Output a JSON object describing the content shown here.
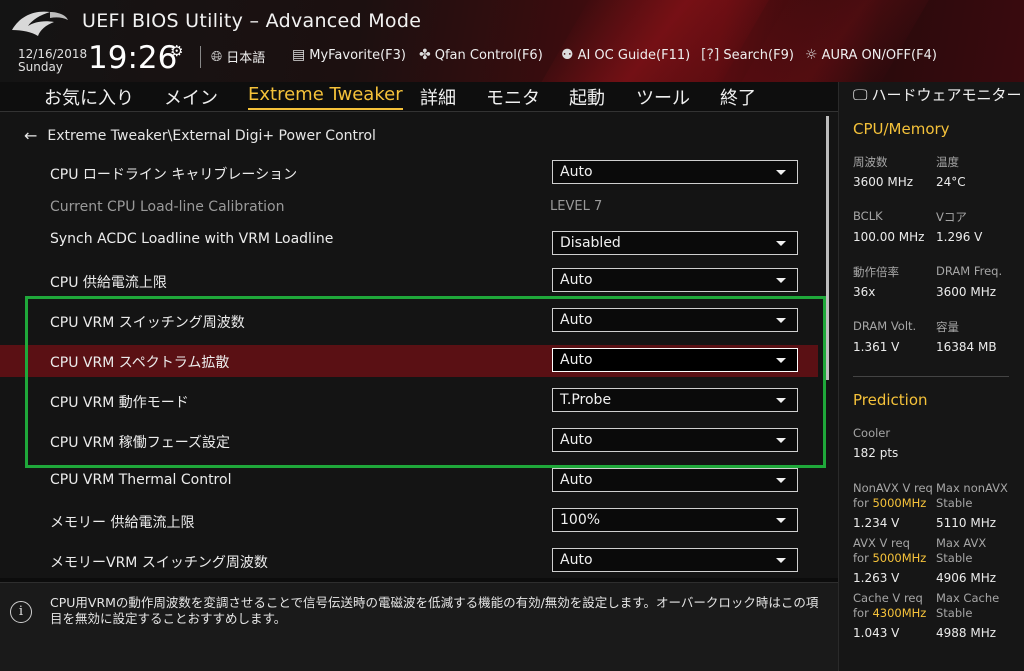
{
  "header": {
    "title": "UEFI BIOS Utility – Advanced Mode",
    "date": "12/16/2018",
    "day": "Sunday",
    "time": "19:26",
    "items": [
      {
        "icon": "globe-icon",
        "label": "日本語"
      },
      {
        "icon": "favorite-icon",
        "label": "MyFavorite(F3)"
      },
      {
        "icon": "fan-icon",
        "label": "Qfan Control(F6)"
      },
      {
        "icon": "ai-guide-icon",
        "label": "AI OC Guide(F11)"
      },
      {
        "icon": "search-icon",
        "label": "Search(F9)"
      },
      {
        "icon": "aura-icon",
        "label": "AURA ON/OFF(F4)"
      }
    ]
  },
  "menu": {
    "tabs": [
      "お気に入り",
      "メイン",
      "Extreme Tweaker",
      "詳細",
      "モニタ",
      "起動",
      "ツール",
      "終了"
    ],
    "active": "Extreme Tweaker"
  },
  "main": {
    "breadcrumb": "Extreme Tweaker\\External Digi+ Power Control",
    "rows": [
      {
        "label": "CPU ロードライン キャリブレーション",
        "value": "Auto"
      },
      {
        "label": "Current CPU Load-line Calibration",
        "value": "LEVEL 7"
      },
      {
        "label": "Synch ACDC Loadline with VRM Loadline",
        "value": "Disabled"
      },
      {
        "label": "CPU 供給電流上限",
        "value": "Auto"
      },
      {
        "label": "CPU VRM スイッチング周波数",
        "value": "Auto"
      },
      {
        "label": "CPU VRM スペクトラム拡散",
        "value": "Auto"
      },
      {
        "label": "CPU VRM 動作モード",
        "value": "T.Probe"
      },
      {
        "label": "CPU VRM 稼働フェーズ設定",
        "value": "Auto"
      },
      {
        "label": "CPU VRM Thermal Control",
        "value": "Auto"
      },
      {
        "label": "メモリー 供給電流上限",
        "value": "100%"
      },
      {
        "label": "メモリーVRM スイッチング周波数",
        "value": "Auto"
      }
    ]
  },
  "info": {
    "text": "CPU用VRMの動作周波数を変調させることで信号伝送時の電磁波を低減する機能の有効/無効を設定します。オーバークロック時はこの項目を無効に設定することおすすめします。"
  },
  "side": {
    "title": "ハードウェアモニター",
    "cpu_memory": {
      "heading": "CPU/Memory",
      "freq_label": "周波数",
      "freq_value": "3600 MHz",
      "temp_label": "温度",
      "temp_value": "24°C",
      "bclk_label": "BCLK",
      "bclk_value": "100.00 MHz",
      "vcore_label": "Vコア",
      "vcore_value": "1.296 V",
      "ratio_label": "動作倍率",
      "ratio_value": "36x",
      "dramfreq_label": "DRAM Freq.",
      "dramfreq_value": "3600 MHz",
      "dramvolt_label": "DRAM Volt.",
      "dramvolt_value": "1.361 V",
      "capacity_label": "容量",
      "capacity_value": "16384 MB"
    },
    "prediction": {
      "heading": "Prediction",
      "cooler_label": "Cooler",
      "cooler_value": "182 pts",
      "nonavx_label": "NonAVX V req",
      "nonavx_for": "for ",
      "nonavx_freq": "5000MHz",
      "nonavx_value": "1.234 V",
      "maxnonavx_label": "Max nonAVX",
      "maxnonavx_sub": "Stable",
      "maxnonavx_value": "5110 MHz",
      "avx_label": "AVX V req",
      "avx_for": "for ",
      "avx_freq": "5000MHz",
      "avx_value": "1.263 V",
      "maxavx_label": "Max AVX",
      "maxavx_sub": "Stable",
      "maxavx_value": "4906 MHz",
      "cache_label": "Cache V req",
      "cache_for": "for ",
      "cache_freq": "4300MHz",
      "cache_value": "1.043 V",
      "maxcache_label": "Max Cache",
      "maxcache_sub": "Stable",
      "maxcache_value": "4988 MHz"
    }
  },
  "colors": {
    "accent": "#f5c23a",
    "highlight_row": "#5a1014",
    "green_box": "#1fa83a"
  }
}
